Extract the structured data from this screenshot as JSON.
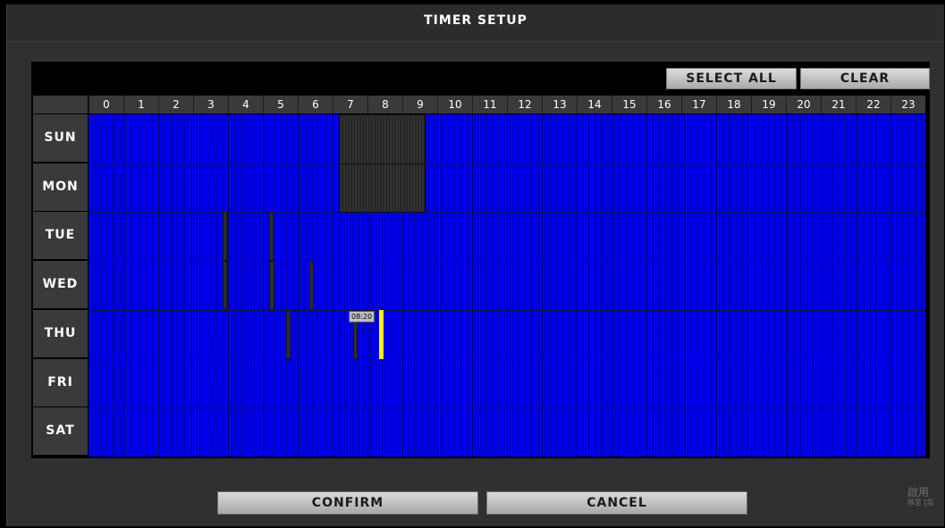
{
  "window": {
    "title": "TIMER SETUP"
  },
  "toolbar": {
    "select_all_label": "SELECT ALL",
    "clear_label": "CLEAR"
  },
  "grid": {
    "hours": [
      "0",
      "1",
      "2",
      "3",
      "4",
      "5",
      "6",
      "7",
      "8",
      "9",
      "10",
      "11",
      "12",
      "13",
      "14",
      "15",
      "16",
      "17",
      "18",
      "19",
      "20",
      "21",
      "22",
      "23"
    ],
    "days": [
      "SUN",
      "MON",
      "TUE",
      "WED",
      "THU",
      "FRI",
      "SAT"
    ],
    "slots_per_hour": 12,
    "inactive_color": "#0000ff",
    "active_color": "#333333",
    "selected_ranges": [
      {
        "day": "SUN",
        "start": "07:10",
        "end": "09:40"
      },
      {
        "day": "MON",
        "start": "07:10",
        "end": "09:40"
      },
      {
        "day": "TUE",
        "start": "03:50",
        "end": "03:55"
      },
      {
        "day": "TUE",
        "start": "05:10",
        "end": "05:15"
      },
      {
        "day": "WED",
        "start": "03:50",
        "end": "03:55"
      },
      {
        "day": "WED",
        "start": "05:10",
        "end": "05:20"
      },
      {
        "day": "WED",
        "start": "06:20",
        "end": "06:25"
      },
      {
        "day": "THU",
        "start": "05:40",
        "end": "05:45"
      },
      {
        "day": "THU",
        "start": "07:35",
        "end": "07:40"
      }
    ],
    "cursor": {
      "day": "THU",
      "time": "08:20",
      "color": "#ffef00"
    }
  },
  "footer": {
    "confirm_label": "CONFIRM",
    "cancel_label": "CANCEL"
  },
  "watermark": {
    "line1": "啟用",
    "line2": "移至 [設"
  }
}
